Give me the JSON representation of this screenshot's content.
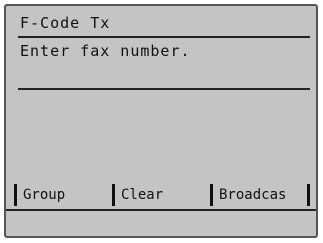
{
  "screen": {
    "title": "F-Code Tx",
    "prompt": "Enter fax number.",
    "fax_number_value": ""
  },
  "softkeys": [
    {
      "label": "Group"
    },
    {
      "label": "Clear"
    },
    {
      "label": "Broadcas"
    }
  ],
  "colors": {
    "lcd_background": "#d9d9d9",
    "lcd_text": "#111111"
  }
}
